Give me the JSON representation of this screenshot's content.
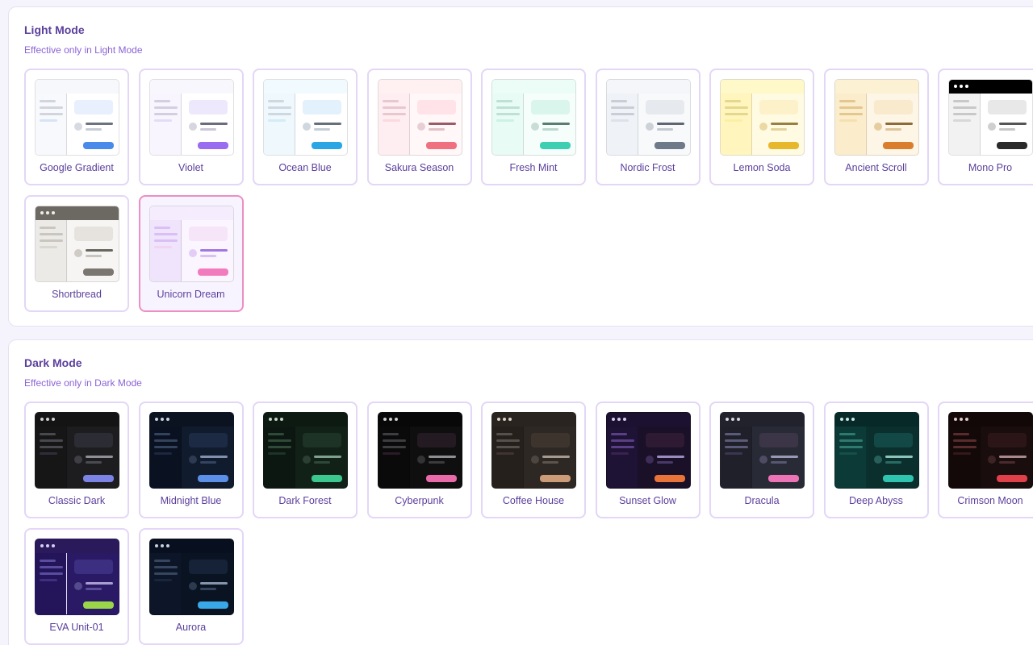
{
  "light": {
    "title": "Light Mode",
    "subtitle": "Effective only in Light Mode",
    "themes": [
      {
        "name": "Google Gradient",
        "top": "#f7f8fb",
        "side": "#f7f9fc",
        "main": "#ffffff",
        "block": "#e8effd",
        "line": "#d0d5de",
        "hl": "#d6e4f8",
        "circle": "#d7dae0",
        "txt": "#6b7280",
        "txt2": "#c7ccd5",
        "btn": "#4a8aea",
        "dots": false
      },
      {
        "name": "Violet",
        "top": "#f9f7fe",
        "side": "#f8f5fe",
        "main": "#ffffff",
        "block": "#eee8fd",
        "line": "#d3cfe0",
        "hl": "#e4dcf7",
        "circle": "#d7d5e0",
        "txt": "#6b6b7e",
        "txt2": "#cac7d6",
        "btn": "#9a6cf0",
        "dots": false
      },
      {
        "name": "Ocean Blue",
        "top": "#f1fafe",
        "side": "#eef8fd",
        "main": "#ffffff",
        "block": "#e2f1fc",
        "line": "#cdd8e0",
        "hl": "#d4ecf8",
        "circle": "#d0d7de",
        "txt": "#66707a",
        "txt2": "#c5ced6",
        "btn": "#2aa6e4",
        "dots": false
      },
      {
        "name": "Sakura Season",
        "top": "#fff0f2",
        "side": "#ffeef1",
        "main": "#fff7f8",
        "block": "#ffe3e8",
        "line": "#e8c8cf",
        "hl": "#fbd9df",
        "circle": "#e8cfd5",
        "txt": "#9a5a66",
        "txt2": "#e2c1c8",
        "btn": "#f0707f",
        "dots": false
      },
      {
        "name": "Fresh Mint",
        "top": "#ecfdf7",
        "side": "#e8fbf4",
        "main": "#f5fefb",
        "block": "#daf6ec",
        "line": "#bfe0d4",
        "hl": "#cdf1e4",
        "circle": "#c9ddd6",
        "txt": "#5a7d72",
        "txt2": "#bdd8cf",
        "btn": "#3ccfb1",
        "dots": false
      },
      {
        "name": "Nordic Frost",
        "top": "#f4f6f9",
        "side": "#eff2f6",
        "main": "#f8f9fb",
        "block": "#e6e9ee",
        "line": "#c9ced6",
        "hl": "#dde2ea",
        "circle": "#cdd1d8",
        "txt": "#5e6673",
        "txt2": "#c4c9d1",
        "btn": "#6e7a8a",
        "dots": false
      },
      {
        "name": "Lemon Soda",
        "top": "#fff8c8",
        "side": "#fff5bd",
        "main": "#fffbe3",
        "block": "#fcf1c8",
        "line": "#e6d78e",
        "hl": "#fcefa4",
        "circle": "#ead9a5",
        "txt": "#9a8040",
        "txt2": "#e3d39c",
        "btn": "#e8b82c",
        "dots": false
      },
      {
        "name": "Ancient Scroll",
        "top": "#fdf1d4",
        "side": "#fbedcb",
        "main": "#fdf6e6",
        "block": "#f9eacd",
        "line": "#e2c790",
        "hl": "#f6dfae",
        "circle": "#e6cda0",
        "txt": "#8c6a3a",
        "txt2": "#dec49a",
        "btn": "#da7e2e",
        "dots": false
      },
      {
        "name": "Mono Pro",
        "top": "#000000",
        "side": "#f2f2f2",
        "main": "#ffffff",
        "block": "#e8e8e8",
        "line": "#c8c8c8",
        "hl": "#d8d8d8",
        "circle": "#cfcfcf",
        "txt": "#555555",
        "txt2": "#c6c6c6",
        "btn": "#2a2a2a",
        "dots": true,
        "dotColor": "#ffffff"
      },
      {
        "name": "Shortbread",
        "top": "#6c6862",
        "side": "#eceae7",
        "main": "#f6f5f3",
        "block": "#e6e3df",
        "line": "#c9c5bf",
        "hl": "#dad6d0",
        "circle": "#cfcbc5",
        "txt": "#6a665f",
        "txt2": "#c8c4be",
        "btn": "#7b766f",
        "dots": true,
        "dotColor": "#f0eeeb"
      },
      {
        "name": "Unicorn Dream",
        "top": "#f5edfd",
        "side": "#efe4fc",
        "main": "#faf5fe",
        "block": "#f6e4f8",
        "line": "#d9bff3",
        "hl": "#f3d4f0",
        "circle": "#e3cdf6",
        "txt": "#a078e0",
        "txt2": "#d8c2f4",
        "btn": "#f27bbd",
        "dots": false,
        "selected": true
      }
    ]
  },
  "dark": {
    "title": "Dark Mode",
    "subtitle": "Effective only in Dark Mode",
    "themes": [
      {
        "name": "Classic Dark",
        "top": "#141414",
        "side": "#161616",
        "main": "#1d1d1f",
        "block": "#2c2c35",
        "line": "#48484f",
        "hl": "#2e2e3a",
        "circle": "#3e3e45",
        "txt": "#8f8f97",
        "txt2": "#4a4a52",
        "btn": "#7b83e4",
        "dots": true,
        "dotColor": "#cfcfcf"
      },
      {
        "name": "Midnight Blue",
        "top": "#0b1220",
        "side": "#0a1120",
        "main": "#111b2e",
        "block": "#1c2a44",
        "line": "#33425d",
        "hl": "#1b2840",
        "circle": "#2e3a52",
        "txt": "#8090ad",
        "txt2": "#344361",
        "btn": "#5b8fe8",
        "dots": true,
        "dotColor": "#c9d2e3"
      },
      {
        "name": "Dark Forest",
        "top": "#0d1a12",
        "side": "#0c1711",
        "main": "#122118",
        "block": "#1c3325",
        "line": "#2e4a38",
        "hl": "#1c3526",
        "circle": "#2b3f33",
        "txt": "#7fa08c",
        "txt2": "#2f4838",
        "btn": "#3cc78e",
        "dots": true,
        "dotColor": "#c6d6cc"
      },
      {
        "name": "Cyberpunk",
        "top": "#080808",
        "side": "#0a0a0a",
        "main": "#0f0f10",
        "block": "#241b22",
        "line": "#3d3d40",
        "hl": "#2a1c26",
        "circle": "#333336",
        "txt": "#8e8e93",
        "txt2": "#3b3b3e",
        "btn": "#e86aa8",
        "dots": true,
        "dotColor": "#d0d0d0"
      },
      {
        "name": "Coffee House",
        "top": "#2a2420",
        "side": "#25201c",
        "main": "#2e2824",
        "block": "#3d342e",
        "line": "#57504a",
        "hl": "#3f3530",
        "circle": "#4d4540",
        "txt": "#a49a90",
        "txt2": "#5b534c",
        "btn": "#cc9c78",
        "dots": true,
        "dotColor": "#dcd2c8"
      },
      {
        "name": "Sunset Glow",
        "top": "#1c1130",
        "side": "#1e1235",
        "main": "#1a1028",
        "block": "#2e1a33",
        "line": "#5a3f86",
        "hl": "#3a2150",
        "circle": "#3e2d58",
        "txt": "#9b8cc0",
        "txt2": "#4a3868",
        "btn": "#e8743a",
        "dots": true,
        "dotColor": "#d8ccf0"
      },
      {
        "name": "Dracula",
        "top": "#21222c",
        "side": "#1f2029",
        "main": "#282a36",
        "block": "#3c3548",
        "line": "#5b5a78",
        "hl": "#3b3551",
        "circle": "#4d4c63",
        "txt": "#9a98b4",
        "txt2": "#585770",
        "btn": "#ec73b5",
        "dots": true,
        "dotColor": "#d6d6e4"
      },
      {
        "name": "Deep Abyss",
        "top": "#072a28",
        "side": "#0b3a37",
        "main": "#0a2f2d",
        "block": "#124845",
        "line": "#2f7a70",
        "hl": "#164f4a",
        "circle": "#27605a",
        "txt": "#8cc4bb",
        "txt2": "#2a6b64",
        "btn": "#2fc4b0",
        "dots": true,
        "dotColor": "#c9e7e2"
      },
      {
        "name": "Crimson Moon",
        "top": "#120808",
        "side": "#140909",
        "main": "#1a0d0d",
        "block": "#2c1516",
        "line": "#5a2b2e",
        "hl": "#351819",
        "circle": "#3e2324",
        "txt": "#a88a8c",
        "txt2": "#4a2a2c",
        "btn": "#e0404a",
        "dots": true,
        "dotColor": "#e2c8c8"
      },
      {
        "name": "EVA Unit-01",
        "top": "#2a1a5c",
        "side": "#24155a",
        "main": "#2a1a66",
        "block": "#3c2e80",
        "line": "#5a4c9e",
        "hl": "#3e2e84",
        "circle": "#544a8c",
        "txt": "#a89ed4",
        "txt2": "#5a4e98",
        "btn": "#9ad54a",
        "dots": true,
        "dotColor": "#d6cdf3",
        "sideBorder": "#e8e4f8"
      },
      {
        "name": "Aurora",
        "top": "#08101f",
        "side": "#0c1628",
        "main": "#0a1322",
        "block": "#152238",
        "line": "#36465e",
        "hl": "#18263e",
        "circle": "#2c3a50",
        "txt": "#8595ac",
        "txt2": "#34445c",
        "btn": "#38a8e8",
        "dots": true,
        "dotColor": "#c6d0de"
      }
    ]
  }
}
